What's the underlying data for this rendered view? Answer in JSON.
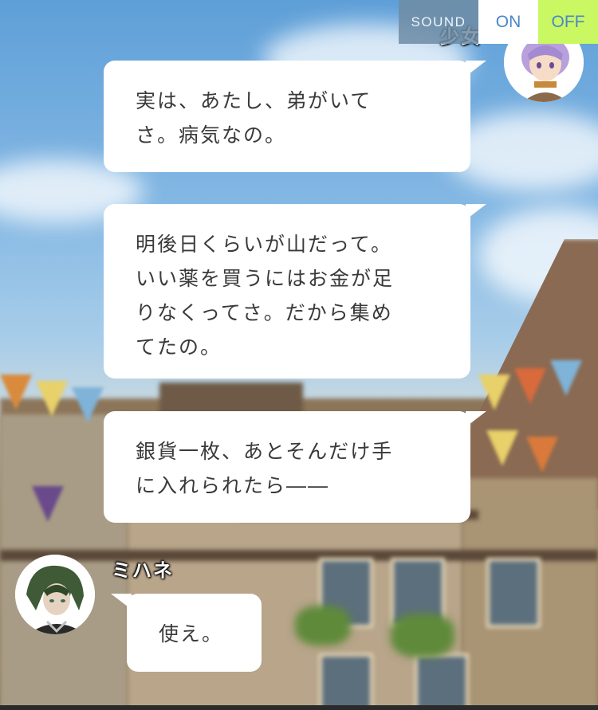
{
  "sound": {
    "label": "SOUND",
    "on_label": "ON",
    "off_label": "OFF",
    "selected": "OFF",
    "selected_color": "#c9f862"
  },
  "messages": [
    {
      "speaker": "少女",
      "side": "right",
      "text": "実は、あたし、弟がいて\nさ。病気なの。"
    },
    {
      "speaker": "少女",
      "side": "right",
      "text": "明後日くらいが山だって。\nいい薬を買うにはお金が足\nりなくってさ。だから集め\nてたの。"
    },
    {
      "speaker": "少女",
      "side": "right",
      "text": "銀貨一枚、あとそんだけ手\nに入れられたら――"
    },
    {
      "speaker": "ミハネ",
      "side": "left",
      "text": "使え。"
    }
  ],
  "avatars": {
    "girl": "purple-haired-girl-avatar",
    "mihane": "green-haired-man-avatar"
  }
}
